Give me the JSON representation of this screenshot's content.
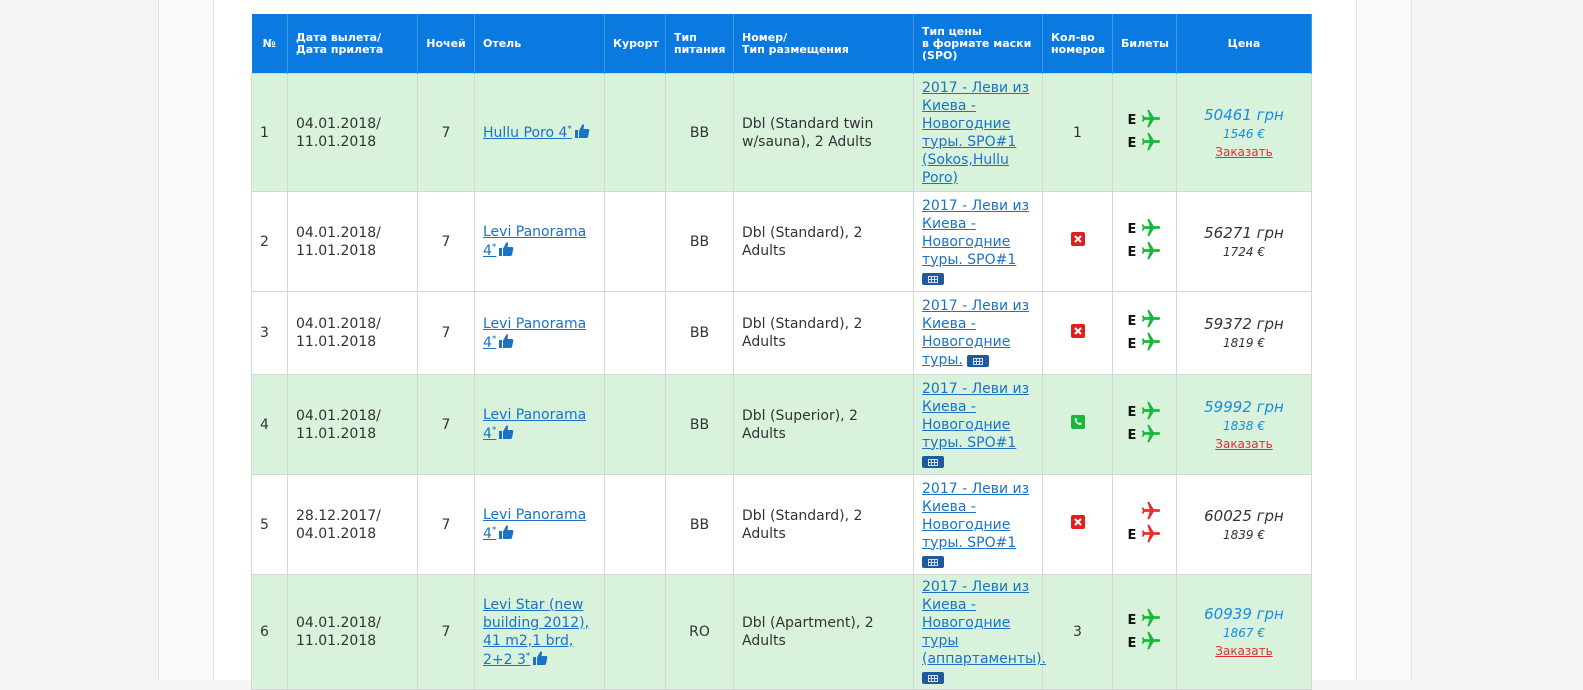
{
  "headers": {
    "num": "№",
    "dates_l1": "Дата вылета/",
    "dates_l2": "Дата прилета",
    "nights": "Ночей",
    "hotel": "Отель",
    "resort": "Курорт",
    "meal_l1": "Тип",
    "meal_l2": "питания",
    "room_l1": "Номер/",
    "room_l2": "Тип размещения",
    "price_type_l1": "Тип цены",
    "price_type_l2": "в формате маски",
    "price_type_l3": "(SPO)",
    "rooms_l1": "Кол-во",
    "rooms_l2": "номеров",
    "tickets": "Билеты",
    "price": "Цена"
  },
  "ticket_class": "E",
  "order_label": "Заказать",
  "colors": {
    "header_bg": "#0a7ae0",
    "highlight_row": "#d8f2dc",
    "ticket_ok": "#1ab83a",
    "ticket_bad": "#e62e2e",
    "status_no": "#e02020",
    "status_phone": "#1ab83a",
    "price_available": "#1a8be0"
  },
  "rows": [
    {
      "num": "1",
      "date_out": "04.01.2018/",
      "date_in": "11.01.2018",
      "nights": "7",
      "hotel_l1": "Hullu Poro 4",
      "hotel_l2": "",
      "hotel_l3": "",
      "hotel_l4": "",
      "hotel_star": "*",
      "resort": "",
      "meal": "BB",
      "room_l1": "Dbl (Standard twin",
      "room_l2": "w/sauna), 2 Adults",
      "spo": [
        "2017 - Леви из",
        "Киева -",
        "Новогодние",
        "туры. SPO#1",
        "(Sokos,Hullu",
        "Poro)"
      ],
      "calendar": false,
      "rooms": "1",
      "rooms_icon": "",
      "out_ticket_class": "E",
      "out_ticket_icon": "plane-green",
      "in_ticket_class": "E",
      "in_ticket_icon": "plane-green",
      "price_uah": "50461 грн",
      "price_eur": "1546 €",
      "available": true
    },
    {
      "num": "2",
      "date_out": "04.01.2018/",
      "date_in": "11.01.2018",
      "nights": "7",
      "hotel_l1": "Levi Panorama",
      "hotel_l2": "4",
      "hotel_l3": "",
      "hotel_l4": "",
      "hotel_star": "*",
      "resort": "",
      "meal": "BB",
      "room_l1": "Dbl (Standard), 2 Adults",
      "room_l2": "",
      "spo": [
        "2017 - Леви из",
        "Киева -",
        "Новогодние",
        "туры. SPO#1"
      ],
      "calendar": true,
      "rooms": "",
      "rooms_icon": "stop-sale",
      "out_ticket_class": "E",
      "out_ticket_icon": "plane-green",
      "in_ticket_class": "E",
      "in_ticket_icon": "plane-green",
      "price_uah": "56271 грн",
      "price_eur": "1724 €",
      "available": false
    },
    {
      "num": "3",
      "date_out": "04.01.2018/",
      "date_in": "11.01.2018",
      "nights": "7",
      "hotel_l1": "Levi Panorama",
      "hotel_l2": "4",
      "hotel_l3": "",
      "hotel_l4": "",
      "hotel_star": "*",
      "resort": "",
      "meal": "BB",
      "room_l1": "Dbl (Standard), 2 Adults",
      "room_l2": "",
      "spo": [
        "2017 - Леви из",
        "Киева -",
        "Новогодние",
        "туры."
      ],
      "calendar": true,
      "rooms": "",
      "rooms_icon": "stop-sale",
      "out_ticket_class": "E",
      "out_ticket_icon": "plane-green",
      "in_ticket_class": "E",
      "in_ticket_icon": "plane-green",
      "price_uah": "59372 грн",
      "price_eur": "1819 €",
      "available": false
    },
    {
      "num": "4",
      "date_out": "04.01.2018/",
      "date_in": "11.01.2018",
      "nights": "7",
      "hotel_l1": "Levi Panorama",
      "hotel_l2": "4",
      "hotel_l3": "",
      "hotel_l4": "",
      "hotel_star": "*",
      "resort": "",
      "meal": "BB",
      "room_l1": "Dbl (Superior), 2 Adults",
      "room_l2": "",
      "spo": [
        "2017 - Леви из",
        "Киева -",
        "Новогодние",
        "туры. SPO#1"
      ],
      "calendar": true,
      "rooms": "",
      "rooms_icon": "on-request",
      "out_ticket_class": "E",
      "out_ticket_icon": "plane-green",
      "in_ticket_class": "E",
      "in_ticket_icon": "plane-green",
      "price_uah": "59992 грн",
      "price_eur": "1838 €",
      "available": true
    },
    {
      "num": "5",
      "date_out": "28.12.2017/",
      "date_in": "04.01.2018",
      "nights": "7",
      "hotel_l1": "Levi Panorama",
      "hotel_l2": "4",
      "hotel_l3": "",
      "hotel_l4": "",
      "hotel_star": "*",
      "resort": "",
      "meal": "BB",
      "room_l1": "Dbl (Standard), 2 Adults",
      "room_l2": "",
      "spo": [
        "2017 - Леви из",
        "Киева -",
        "Новогодние",
        "туры. SPO#1"
      ],
      "calendar": true,
      "rooms": "",
      "rooms_icon": "stop-sale",
      "out_ticket_class": "",
      "out_ticket_icon": "plane-red",
      "in_ticket_class": "E",
      "in_ticket_icon": "plane-red",
      "price_uah": "60025 грн",
      "price_eur": "1839 €",
      "available": false
    },
    {
      "num": "6",
      "date_out": "04.01.2018/",
      "date_in": "11.01.2018",
      "nights": "7",
      "hotel_l1": "Levi Star (new",
      "hotel_l2": "building 2012),",
      "hotel_l3": "41 m2,1 brd,",
      "hotel_l4": "2+2 3",
      "hotel_star": "*",
      "resort": "",
      "meal": "RO",
      "room_l1": "Dbl (Apartment), 2",
      "room_l2": "Adults",
      "spo": [
        "2017 - Леви из",
        "Киева -",
        "Новогодние",
        "туры",
        "(аппартаменты)."
      ],
      "calendar": true,
      "rooms": "3",
      "rooms_icon": "",
      "out_ticket_class": "E",
      "out_ticket_icon": "plane-green",
      "in_ticket_class": "E",
      "in_ticket_icon": "plane-green",
      "price_uah": "60939 грн",
      "price_eur": "1867 €",
      "available": true
    }
  ]
}
